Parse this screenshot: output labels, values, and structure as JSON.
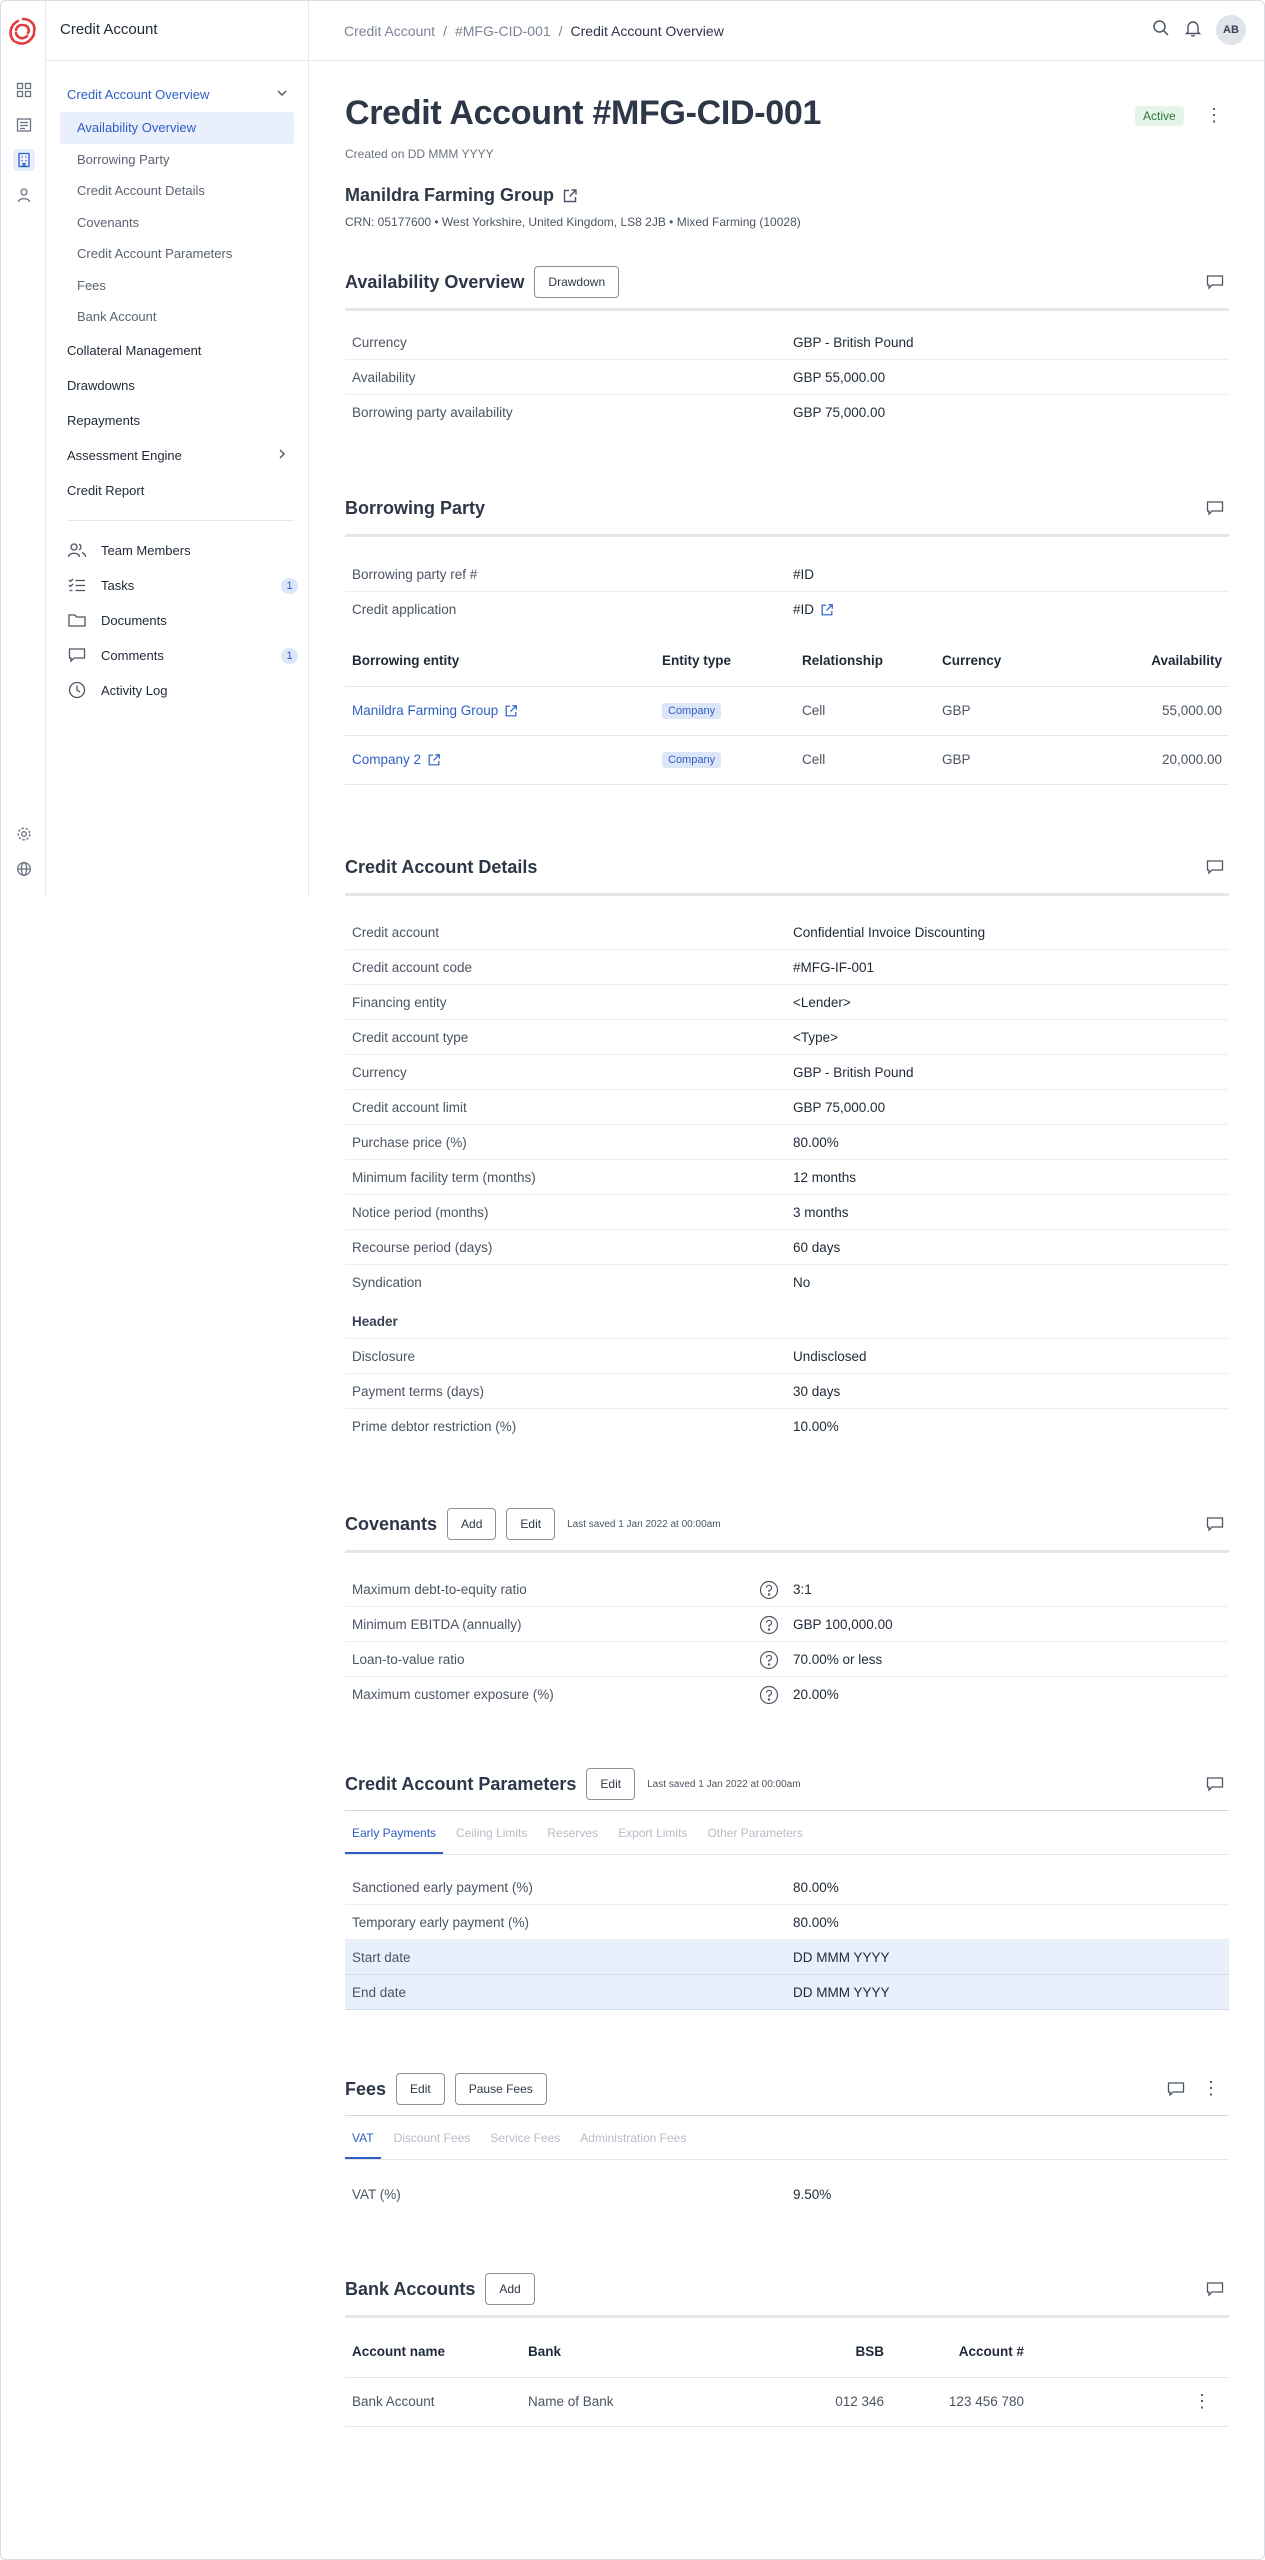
{
  "app": {
    "section_title": "Credit Account"
  },
  "breadcrumb": [
    "Credit Account",
    "#MFG-CID-001",
    "Credit Account Overview"
  ],
  "breadcrumb_sep": "/",
  "user": {
    "initials": "AB"
  },
  "sidebar": {
    "items": [
      {
        "label": "Credit Account Overview",
        "selected": true,
        "expanded": true
      },
      {
        "label": "Availability Overview",
        "sub": true,
        "active": true
      },
      {
        "label": "Borrowing Party",
        "sub": true
      },
      {
        "label": "Credit Account Details",
        "sub": true
      },
      {
        "label": "Covenants",
        "sub": true
      },
      {
        "label": "Credit Account Parameters",
        "sub": true
      },
      {
        "label": "Fees",
        "sub": true
      },
      {
        "label": "Bank Account",
        "sub": true
      },
      {
        "label": "Collateral Management"
      },
      {
        "label": "Drawdowns"
      },
      {
        "label": "Repayments"
      },
      {
        "label": "Assessment Engine",
        "has_children": true
      },
      {
        "label": "Credit Report"
      }
    ],
    "tools": [
      {
        "label": "Team Members",
        "icon": "team-icon"
      },
      {
        "label": "Tasks",
        "icon": "tasks-icon",
        "badge": "1"
      },
      {
        "label": "Documents",
        "icon": "folder-icon"
      },
      {
        "label": "Comments",
        "icon": "comment-icon",
        "badge": "1"
      },
      {
        "label": "Activity Log",
        "icon": "clock-icon"
      }
    ]
  },
  "header": {
    "title": "Credit Account #MFG-CID-001",
    "created": "Created on DD MMM YYYY",
    "status": "Active",
    "org_name": "Manildra Farming Group",
    "crn": "CRN: 05177600 • West Yorkshire, United Kingdom, LS8 2JB • Mixed Farming (10028)"
  },
  "availability": {
    "title": "Availability Overview",
    "button": "Drawdown",
    "rows": [
      {
        "k": "Currency",
        "v": "GBP - British Pound"
      },
      {
        "k": "Availability",
        "v": "GBP 55,000.00"
      },
      {
        "k": "Borrowing party availability",
        "v": "GBP 75,000.00"
      }
    ]
  },
  "borrowing": {
    "title": "Borrowing Party",
    "rows": [
      {
        "k": "Borrowing party ref #",
        "v": "#ID"
      },
      {
        "k": "Credit application",
        "v": "#ID"
      }
    ],
    "columns": [
      "Borrowing entity",
      "Entity type",
      "Relationship",
      "Currency",
      "Availability"
    ],
    "entities": [
      {
        "name": "Manildra Farming Group",
        "type": "Company",
        "relationship": "Cell",
        "currency": "GBP",
        "availability": "55,000.00"
      },
      {
        "name": "Company 2",
        "type": "Company",
        "relationship": "Cell",
        "currency": "GBP",
        "availability": "20,000.00"
      }
    ]
  },
  "details": {
    "title": "Credit Account Details",
    "rows": [
      {
        "k": "Credit account",
        "v": "Confidential Invoice Discounting"
      },
      {
        "k": "Credit account code",
        "v": "#MFG-IF-001"
      },
      {
        "k": "Financing entity",
        "v": "<Lender>"
      },
      {
        "k": "Credit account type",
        "v": "<Type>"
      },
      {
        "k": "Currency",
        "v": "GBP - British Pound"
      },
      {
        "k": "Credit account limit",
        "v": "GBP 75,000.00"
      },
      {
        "k": "Purchase price (%)",
        "v": "80.00%"
      },
      {
        "k": "Minimum facility term (months)",
        "v": "12 months"
      },
      {
        "k": "Notice period (months)",
        "v": "3 months"
      },
      {
        "k": "Recourse period (days)",
        "v": "60 days"
      },
      {
        "k": "Syndication",
        "v": "No"
      }
    ],
    "subheader": "Header",
    "rows2": [
      {
        "k": "Disclosure",
        "v": "Undisclosed"
      },
      {
        "k": "Payment terms (days)",
        "v": "30 days"
      },
      {
        "k": "Prime debtor restriction (%)",
        "v": "10.00%"
      }
    ]
  },
  "covenants": {
    "title": "Covenants",
    "add": "Add",
    "edit": "Edit",
    "saved": "Last saved 1 Jan 2022 at 00:00am",
    "rows": [
      {
        "k": "Maximum debt-to-equity ratio",
        "v": "3:1"
      },
      {
        "k": "Minimum EBITDA (annually)",
        "v": "GBP 100,000.00"
      },
      {
        "k": "Loan-to-value ratio",
        "v": "70.00% or less"
      },
      {
        "k": "Maximum customer exposure (%)",
        "v": "20.00%"
      }
    ]
  },
  "parameters": {
    "title": "Credit Account Parameters",
    "edit": "Edit",
    "saved": "Last saved 1 Jan 2022 at 00:00am",
    "tabs": [
      "Early Payments",
      "Ceiling Limits",
      "Reserves",
      "Export Limits",
      "Other Parameters"
    ],
    "rows": [
      {
        "k": "Sanctioned early payment (%)",
        "v": "80.00%"
      },
      {
        "k": "Temporary early payment (%)",
        "v": "80.00%"
      },
      {
        "k": "Start date",
        "v": "DD MMM YYYY"
      },
      {
        "k": "End date",
        "v": "DD MMM YYYY"
      }
    ]
  },
  "fees": {
    "title": "Fees",
    "edit": "Edit",
    "pause": "Pause Fees",
    "tabs": [
      "VAT",
      "Discount Fees",
      "Service Fees",
      "Administration Fees"
    ],
    "rows": [
      {
        "k": "VAT (%)",
        "v": "9.50%"
      }
    ]
  },
  "bank": {
    "title": "Bank Accounts",
    "add": "Add",
    "columns": [
      "Account name",
      "Bank",
      "BSB",
      "Account #"
    ],
    "rows": [
      {
        "name": "Bank Account",
        "bank": "Name of Bank",
        "bsb": "012 346",
        "acct": "123 456 780"
      }
    ]
  },
  "colors": {
    "accent": "#2f5fc4",
    "active_bg": "#e9effb",
    "status_green": "#2a7a3b",
    "logo_red": "#e23b3b"
  }
}
